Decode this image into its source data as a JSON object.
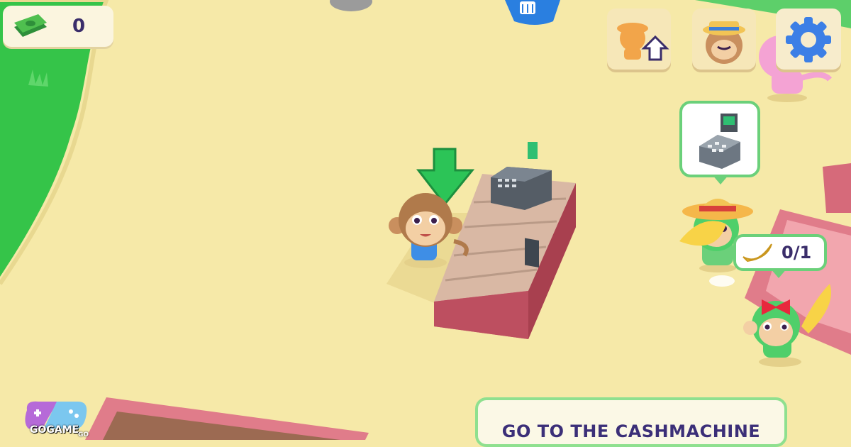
{
  "hud": {
    "money_amount": "0",
    "buttons": [
      {
        "name": "upgrade-workers",
        "icon": "worker-upgrade-icon"
      },
      {
        "name": "hire-manager",
        "icon": "monkey-straw-hat-icon"
      },
      {
        "name": "settings",
        "icon": "gear-icon"
      }
    ]
  },
  "customer_request": {
    "progress_text": "0/1",
    "item_icon": "banana-icon",
    "fulfilled": 0,
    "required": 1
  },
  "cash_bubble": {
    "icon": "cash-register-icon"
  },
  "objective": {
    "text": "GO TO THE CASHMACHINE"
  },
  "branding": {
    "logo_text": "GOGAME",
    "logo_subtext": "GO"
  },
  "colors": {
    "grass": "#35c449",
    "sand": "#f6e9a8",
    "counter_brick": "#c9586a",
    "accent_green": "#6bd07a",
    "text_dark": "#3a2d6a"
  }
}
